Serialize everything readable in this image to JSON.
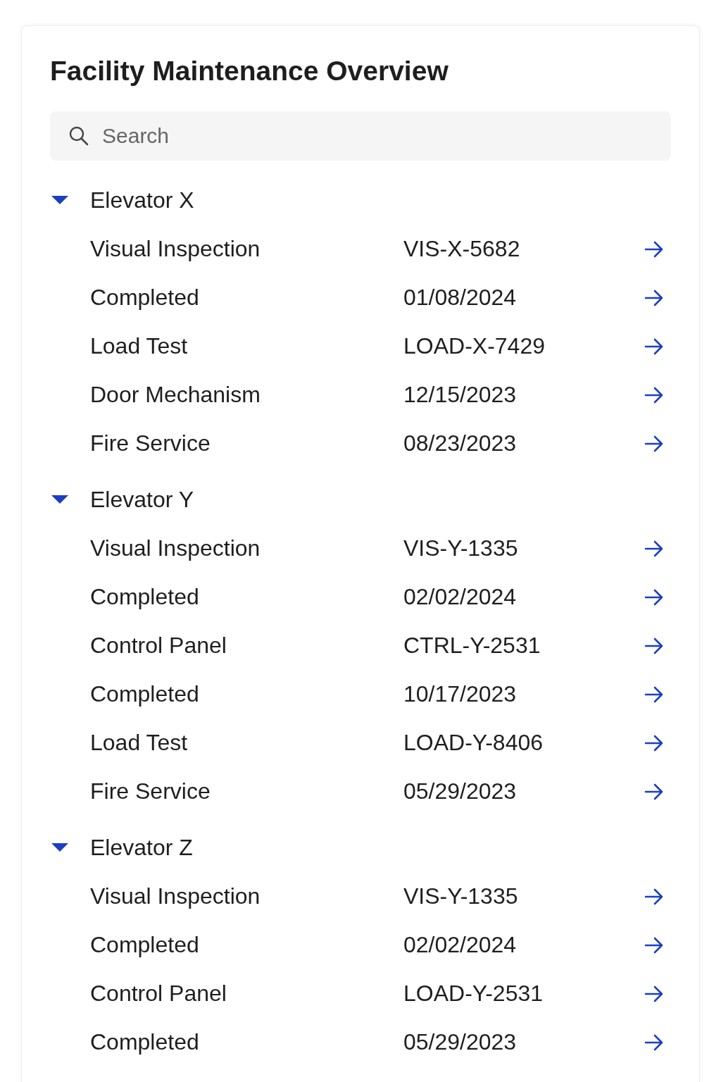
{
  "title": "Facility Maintenance Overview",
  "search": {
    "placeholder": "Search"
  },
  "groups": [
    {
      "label": "Elevator X",
      "expanded": true,
      "rows": [
        {
          "name": "Visual Inspection",
          "value": "VIS-X-5682"
        },
        {
          "name": "Completed",
          "value": "01/08/2024"
        },
        {
          "name": "Load Test",
          "value": "LOAD-X-7429"
        },
        {
          "name": "Door Mechanism",
          "value": "12/15/2023"
        },
        {
          "name": "Fire Service",
          "value": "08/23/2023"
        }
      ]
    },
    {
      "label": "Elevator Y",
      "expanded": true,
      "rows": [
        {
          "name": "Visual Inspection",
          "value": "VIS-Y-1335"
        },
        {
          "name": "Completed",
          "value": "02/02/2024"
        },
        {
          "name": "Control Panel",
          "value": "CTRL-Y-2531"
        },
        {
          "name": "Completed",
          "value": "10/17/2023"
        },
        {
          "name": "Load Test",
          "value": "LOAD-Y-8406"
        },
        {
          "name": "Fire Service",
          "value": "05/29/2023"
        }
      ]
    },
    {
      "label": "Elevator Z",
      "expanded": true,
      "rows": [
        {
          "name": "Visual Inspection",
          "value": "VIS-Y-1335"
        },
        {
          "name": "Completed",
          "value": "02/02/2024"
        },
        {
          "name": "Control Panel",
          "value": "LOAD-Y-2531"
        },
        {
          "name": "Completed",
          "value": "05/29/2023"
        }
      ]
    }
  ]
}
